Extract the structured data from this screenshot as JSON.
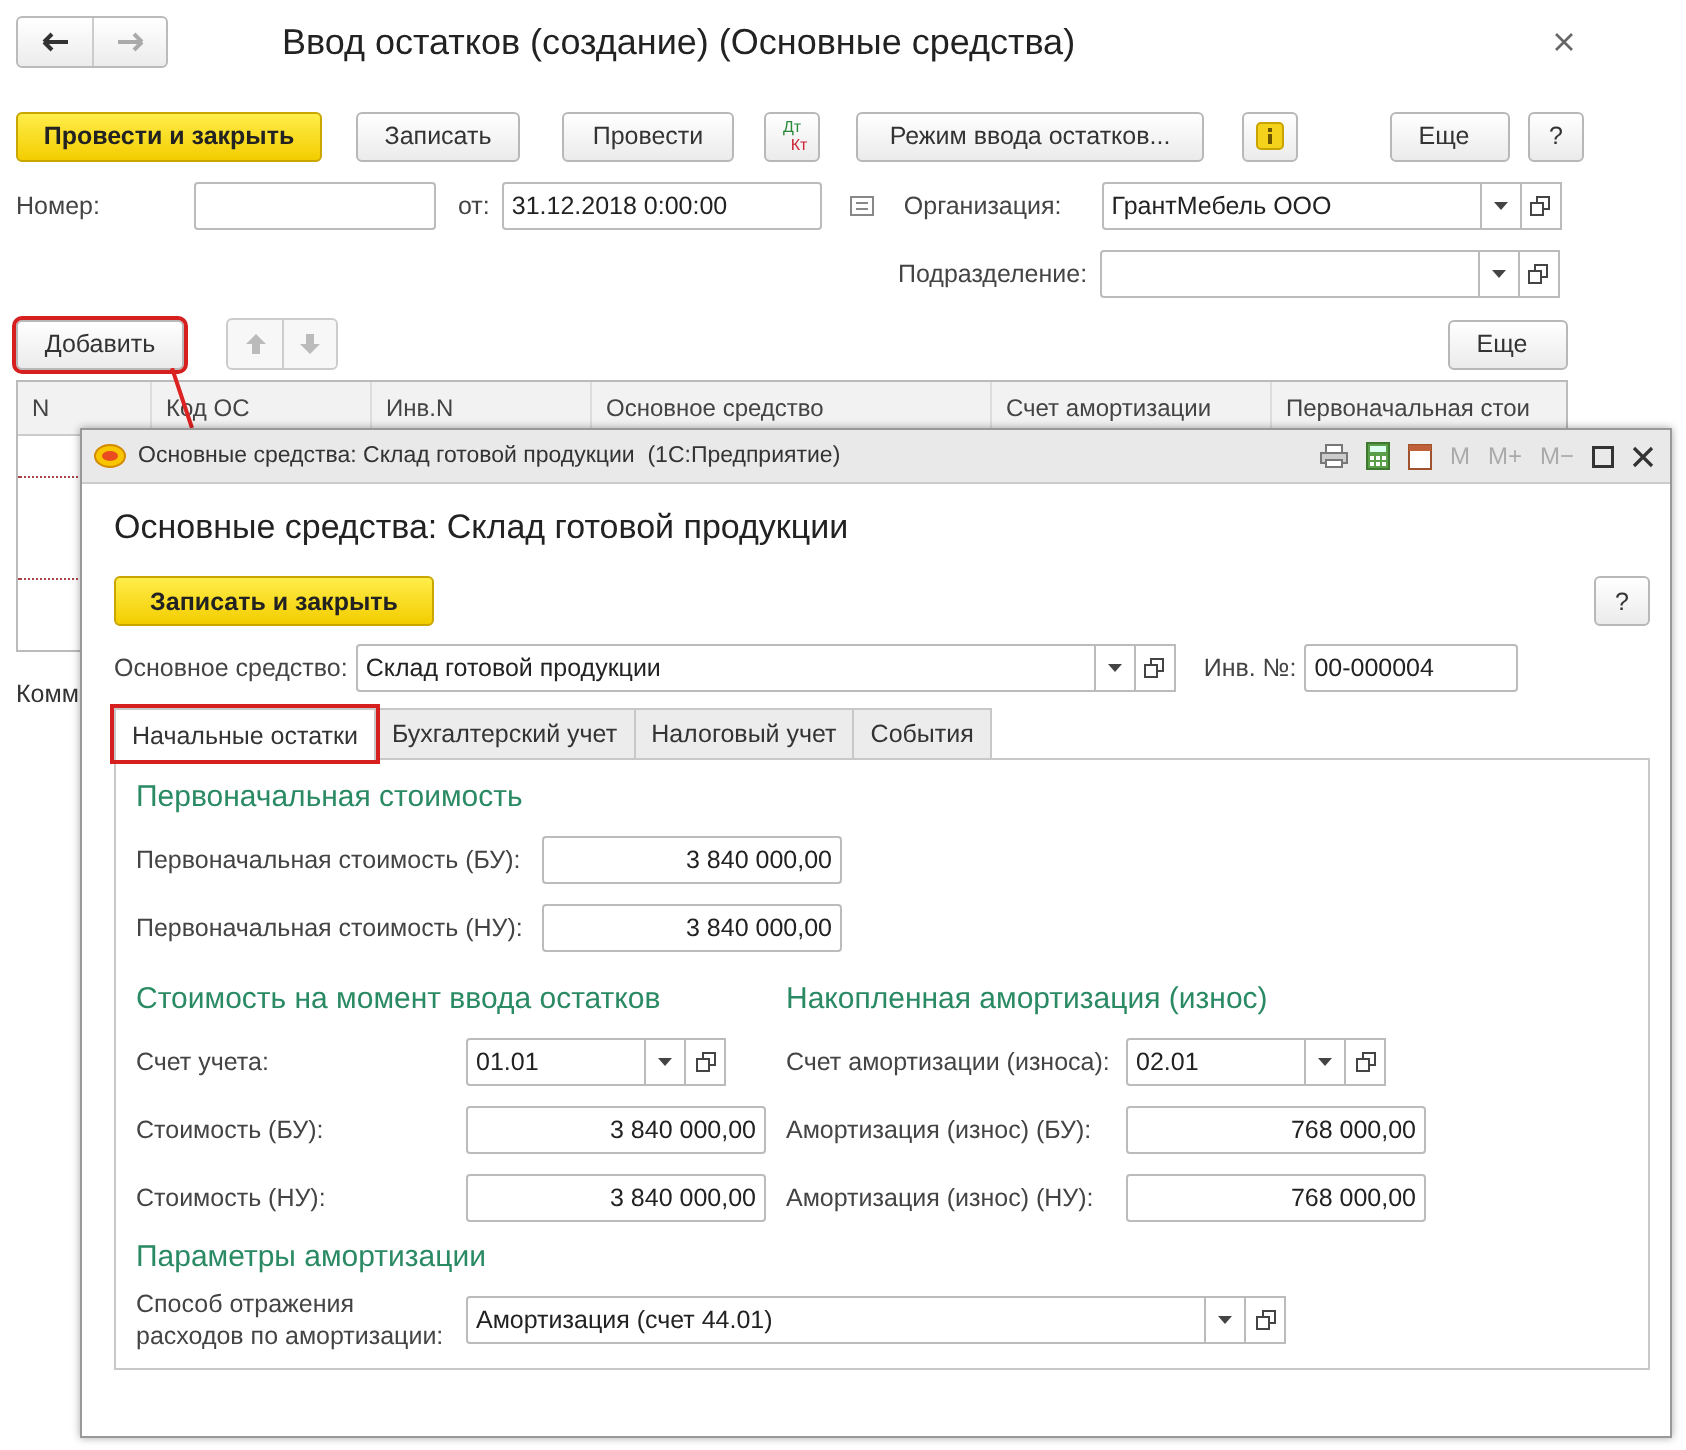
{
  "window": {
    "title": "Ввод остатков (создание) (Основные средства)"
  },
  "toolbar": [
    {
      "kind": "primary",
      "label": "Провести и закрыть"
    },
    {
      "kind": "button",
      "label": "Записать"
    },
    {
      "kind": "button",
      "label": "Провести"
    },
    {
      "kind": "dtkt",
      "top": "Дт",
      "bottom": "Кт"
    },
    {
      "kind": "button",
      "label": "Режим ввода остатков..."
    },
    {
      "kind": "info"
    },
    {
      "kind": "menu",
      "label": "Еще"
    },
    {
      "kind": "button",
      "label": "?"
    }
  ],
  "number": {
    "label": "Номер:"
  },
  "date": {
    "label": "от:",
    "value": "31.12.2018  0:00:00"
  },
  "organization": {
    "label": "Организация:",
    "value": "ГрантМебель ООО"
  },
  "subdivision": {
    "label": "Подразделение:"
  },
  "add_button": {
    "label": "Добавить",
    "highlighted": true
  },
  "table_more": {
    "label": "Еще"
  },
  "table": {
    "columns": [
      "N",
      "Код ОС",
      "Инв.N",
      "Основное средство",
      "Счет амортизации",
      "Первоначальная стои"
    ]
  },
  "comment_label": "Комм",
  "dialog": {
    "title": "Основные средства: Склад готовой продукции  (1С:Предприятие)",
    "memory_buttons": [
      "M",
      "M+",
      "M−"
    ],
    "heading": "Основные средства: Склад готовой продукции",
    "save_close": "Записать и закрыть",
    "help": "?",
    "asset": {
      "label": "Основное средство:",
      "value": "Склад готовой продукции"
    },
    "inv": {
      "label": "Инв. №:",
      "value": "00-000004"
    },
    "tabs": [
      {
        "label": "Начальные остатки",
        "selected": true,
        "highlighted": true
      },
      {
        "label": "Бухгалтерский учет",
        "selected": false,
        "highlighted": false
      },
      {
        "label": "Налоговый учет",
        "selected": false,
        "highlighted": false
      },
      {
        "label": "События",
        "selected": false,
        "highlighted": false
      }
    ],
    "initial": {
      "title": "Первоначальная стоимость",
      "rows": [
        {
          "label": "Первоначальная стоимость (БУ):",
          "value": "3 840 000,00"
        },
        {
          "label": "Первоначальная стоимость (НУ):",
          "value": "3 840 000,00"
        }
      ]
    },
    "cost": {
      "title": "Стоимость на момент ввода остатков",
      "rows": [
        {
          "kind": "select",
          "label": "Счет учета:",
          "value": "01.01"
        },
        {
          "kind": "number",
          "label": "Стоимость (БУ):",
          "value": "3 840 000,00"
        },
        {
          "kind": "number",
          "label": "Стоимость (НУ):",
          "value": "3 840 000,00"
        }
      ]
    },
    "depreciation": {
      "title": "Накопленная амортизация (износ)",
      "rows": [
        {
          "kind": "select",
          "label": "Счет амортизации (износа):",
          "value": "02.01"
        },
        {
          "kind": "number",
          "label": "Амортизация (износ) (БУ):",
          "value": "768 000,00"
        },
        {
          "kind": "number",
          "label": "Амортизация (износ) (НУ):",
          "value": "768 000,00"
        }
      ]
    },
    "params": {
      "title": "Параметры амортизации",
      "label": "Способ отражения расходов по амортизации:",
      "value": "Амортизация (счет 44.01)"
    }
  }
}
